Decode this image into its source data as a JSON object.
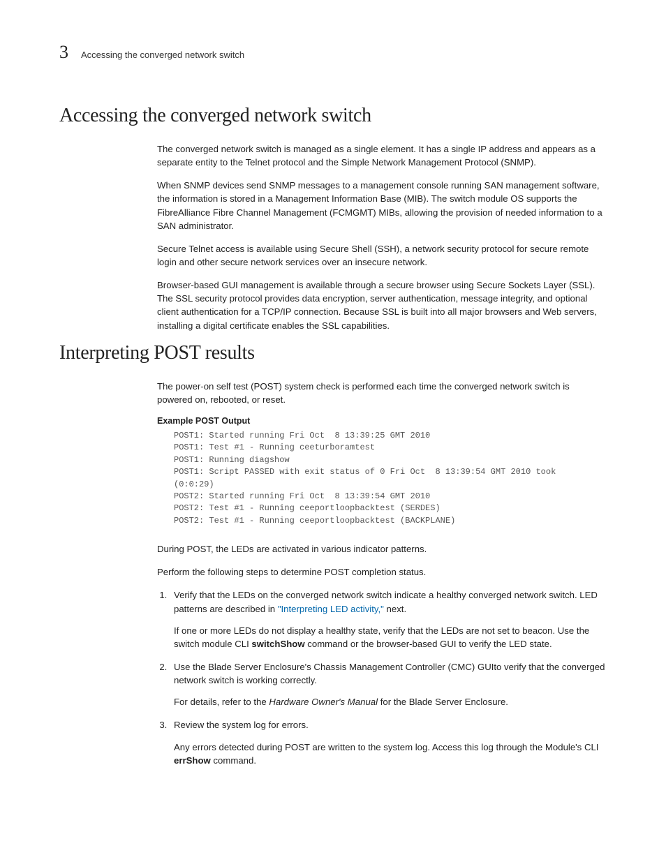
{
  "header": {
    "chapter": "3",
    "running": "Accessing the converged network switch"
  },
  "s1": {
    "title": "Accessing the converged network switch",
    "p1": "The converged network switch is managed as a single element. It has a single IP address and appears as a separate entity to the Telnet protocol and the Simple Network Management Protocol (SNMP).",
    "p2": "When SNMP devices send SNMP messages to a management console running SAN management software, the information is stored in a Management Information Base (MIB). The switch module OS supports the FibreAlliance Fibre Channel Management (FCMGMT) MIBs, allowing the provision of needed information to a SAN administrator.",
    "p3": "Secure Telnet access is available using Secure Shell (SSH), a network security protocol for secure remote login and other secure network services over an insecure network.",
    "p4": "Browser-based GUI management is available through a secure browser using Secure Sockets Layer (SSL). The SSL security protocol provides data encryption, server authentication, message integrity, and optional client authentication for a TCP/IP connection. Because SSL is built into all major browsers and Web servers, installing a digital certificate enables the SSL capabilities."
  },
  "s2": {
    "title": "Interpreting POST results",
    "intro": "The power-on self test (POST) system check is performed each time the converged network switch is powered on, rebooted, or reset.",
    "example_label": "Example  POST Output",
    "code": "POST1: Started running Fri Oct  8 13:39:25 GMT 2010\nPOST1: Test #1 - Running ceeturboramtest\nPOST1: Running diagshow\nPOST1: Script PASSED with exit status of 0 Fri Oct  8 13:39:54 GMT 2010 took\n(0:0:29)\nPOST2: Started running Fri Oct  8 13:39:54 GMT 2010\nPOST2: Test #1 - Running ceeportloopbacktest (SERDES)\nPOST2: Test #1 - Running ceeportloopbacktest (BACKPLANE)",
    "after1": "During POST, the LEDs are activated in various indicator patterns.",
    "after2": "Perform the following steps to determine POST completion status.",
    "step1a": "Verify that the LEDs on the converged network switch indicate a healthy converged network switch. LED patterns are described in ",
    "step1_link": "\"Interpreting LED activity,\"",
    "step1b": " next.",
    "step1_p_a": "If one or more LEDs do not display a healthy state, verify that the LEDs are not set to beacon. Use the switch module CLI ",
    "step1_p_bold": "switchShow",
    "step1_p_b": " command or the browser-based GUI to verify the LED state.",
    "step2a": "Use the Blade Server Enclosure's Chassis Management Controller (CMC) GUIto verify that the converged network switch is working correctly.",
    "step2_p_a": "For details, refer to the ",
    "step2_p_it": "Hardware Owner's Manual",
    "step2_p_b": " for the Blade Server Enclosure.",
    "step3a": "Review the system log for errors.",
    "step3_p_a": "Any errors detected during POST are written to the system log. Access this log through the Module's CLI ",
    "step3_p_bold": "errShow",
    "step3_p_b": " command."
  }
}
